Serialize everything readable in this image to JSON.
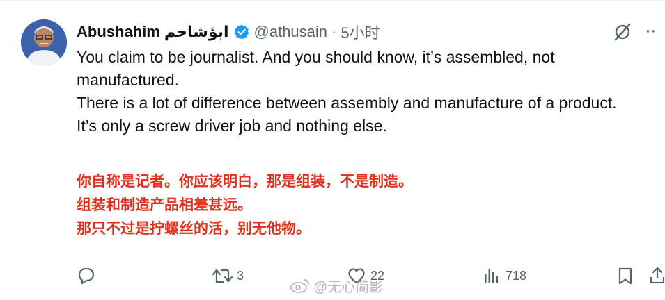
{
  "tweet": {
    "author_name": "Abushahim ابؤشاحم",
    "handle": "@athusain",
    "separator": "·",
    "time": "5小时",
    "text_lines": [
      "You claim to be journalist. And you should know, it’s assembled, not manufactured.",
      "There is a lot of difference between assembly and manufacture of a product.",
      "It’s only a screw driver job and nothing else."
    ],
    "translation_lines": [
      "你自称是记者。你应该明白，那是组装，不是制造。",
      "组装和制造产品相差甚远。",
      "那只不过是拧螺丝的活，别无他物。"
    ],
    "more_label": "··",
    "verified_color": "#1d9bf0"
  },
  "actions": {
    "retweets": "3",
    "likes": "22",
    "views": "718"
  },
  "watermark": {
    "text": "@无心简影"
  },
  "icons": [
    "verified-badge-icon",
    "grok-icon",
    "more-icon",
    "reply-icon",
    "retweet-icon",
    "like-icon",
    "views-icon",
    "bookmark-icon",
    "share-icon",
    "weibo-icon"
  ]
}
